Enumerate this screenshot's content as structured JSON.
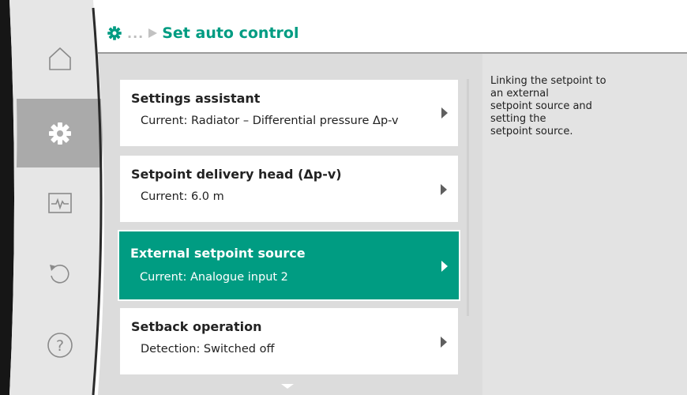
{
  "header": {
    "settings_icon": "gear-icon",
    "breadcrumb_ellipsis": "...",
    "breadcrumb_separator_icon": "triangle-right-icon",
    "title": "Set auto control"
  },
  "nav": [
    {
      "name": "home",
      "icon": "home-icon"
    },
    {
      "name": "settings",
      "icon": "gear-icon",
      "active": true
    },
    {
      "name": "diagnostics",
      "icon": "pulse-monitor-icon"
    },
    {
      "name": "restore",
      "icon": "undo-icon"
    },
    {
      "name": "help",
      "icon": "question-circle-icon"
    }
  ],
  "menu": {
    "items": [
      {
        "title": "Settings assistant",
        "subtitle": "Current: Radiator – Differential pressure Δp-v",
        "selected": false
      },
      {
        "title": "Setpoint delivery head (Δp-v)",
        "subtitle": "Current: 6.0 m",
        "selected": false
      },
      {
        "title": "External setpoint source",
        "subtitle": "Current: Analogue input 2",
        "selected": true
      },
      {
        "title": "Setback operation",
        "subtitle": "Detection: Switched off",
        "selected": false
      }
    ],
    "scroll_down_icon": "chevron-down-icon"
  },
  "help": {
    "lines": [
      "Linking the setpoint to",
      "an external",
      "setpoint source and",
      "setting the",
      "setpoint source."
    ]
  },
  "colors": {
    "accent": "#009c82",
    "panel_gray": "#dcdcdc",
    "sidebar_gray": "#e6e6e6",
    "active_nav": "#aaaaaa",
    "dark_bezel": "#161616"
  }
}
